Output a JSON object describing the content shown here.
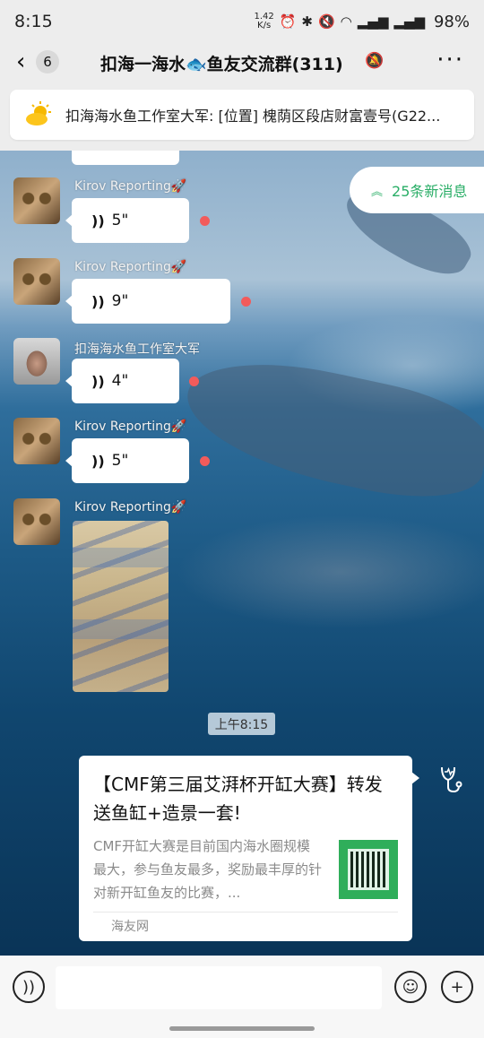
{
  "status_bar": {
    "time": "8:15",
    "net_speed_value": "1.42",
    "net_speed_unit": "K/s",
    "battery": "98%"
  },
  "title_bar": {
    "back_count": "6",
    "title": "扣海一海水🐟鱼友交流群(311)"
  },
  "pinned_notice": {
    "text": "扣海海水鱼工作室大军: [位置] 槐荫区段店财富壹号(G22..."
  },
  "new_messages": {
    "label": "25条新消息"
  },
  "messages": [
    {
      "sender": "Kirov Reporting🚀",
      "duration": "5\""
    },
    {
      "sender": "Kirov Reporting🚀",
      "duration": "9\""
    },
    {
      "sender": "扣海海水鱼工作室大军",
      "duration": "4\""
    },
    {
      "sender": "Kirov Reporting🚀",
      "duration": "5\""
    },
    {
      "sender": "Kirov Reporting🚀"
    }
  ],
  "timestamp": "上午8:15",
  "link_card": {
    "title": "【CMF第三届艾湃杯开缸大赛】转发送鱼缸+造景一套!",
    "description": "CMF开缸大赛是目前国内海水圈规模最大，参与鱼友最多，奖励最丰厚的针对新开缸鱼友的比赛，...",
    "source": "海友网"
  },
  "icons": {
    "back": "chevron-left-icon",
    "mute": "bell-off-icon",
    "more": "more-dots-icon",
    "pinned": "sun-cloud-icon",
    "voice": "voice-wave-icon",
    "emoji": "smile-icon",
    "plus": "plus-icon"
  },
  "colors": {
    "accent_green": "#2aae67",
    "unread_dot": "#f25b5b"
  }
}
